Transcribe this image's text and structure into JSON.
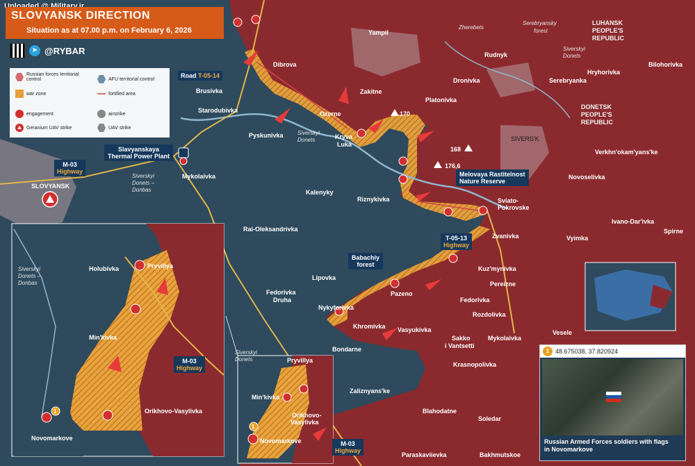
{
  "watermark": "Uploaded @ Military.ir",
  "header": {
    "title": "SLOVYANSK DIRECTION",
    "subtitle": "Situation as at 07.00 p.m. on February 6, 2026"
  },
  "brand": {
    "handle": "@RYBAR"
  },
  "legend": {
    "russian": "Russian forces territorial control",
    "afu": "AFU territorial control",
    "warzone": "war zone",
    "fortified": "fortified area",
    "engagement": "engagement",
    "airstrike": "airstrike",
    "geranium": "Geranium UAV strike",
    "uav": "UAV strike"
  },
  "colors": {
    "russian": "#8b2a2e",
    "afu": "#2e4a5c",
    "warzone": "#e8a33c",
    "road": "#e2b64a",
    "accent": "#d65a18",
    "callout": "#16385c"
  },
  "roads": {
    "t0514": {
      "a": "Road ",
      "b": "T-05-14"
    },
    "m03_top": {
      "a": "M-03",
      "b": "Highway"
    },
    "t0513": {
      "a": "T-05-13",
      "b": "Highway"
    },
    "m03_inset": {
      "a": "M-03",
      "b": "Highway"
    },
    "m03_bottom": {
      "a": "M-03",
      "b": "Highway"
    }
  },
  "callouts": {
    "power_plant": [
      "Slavyanskaya",
      "Thermal Power Plant"
    ],
    "nature_reserve": [
      "Melovaya Rastitelnost",
      "Nature Reserve"
    ],
    "forest": [
      "Babachiy",
      "forest"
    ]
  },
  "regions": {
    "luhansk": [
      "LUHANSK",
      "PEOPLE'S",
      "REPUBLIC"
    ],
    "donetsk": [
      "DONETSK",
      "PEOPLE'S",
      "REPUBLIC"
    ]
  },
  "rivers": {
    "zherebets": "Zherebets",
    "forest": [
      "Serebryansky",
      "forest"
    ],
    "seversky": [
      "Siverskyi",
      "Donets"
    ],
    "seversky_donbas": [
      "Siverskyi",
      "Donets –",
      "Donbas"
    ],
    "seversky_donets": [
      "Siverskyi",
      "Donets"
    ]
  },
  "heights": {
    "h170": "170",
    "h168": "168",
    "h176": "176,6"
  },
  "towns": {
    "yampil": "Yampil",
    "dibrova": "Dibrova",
    "brusivka": "Brusivka",
    "starodubivka": "Starodubivka",
    "zakitne": "Zakitne",
    "ozerne": "Ozerne",
    "platonivka": "Platonivka",
    "dronivka": "Dronivka",
    "rudnyk": "Rudnyk",
    "serebryanka": "Serebryanka",
    "hryhorivka": "Hryhorivka",
    "bilohorivka": "Bilohorivka",
    "siverskyi_donets_lbl": "Siverskyi Donets",
    "pyskunivka": "Pyskunivka",
    "kryva": "Kryva",
    "luka": "Luka",
    "siversk": "SIVERS'K",
    "verkhn": "Verkhn'okam'yans'ke",
    "slovyansk": "SLOVYANSK",
    "mykolaivka": "Mykolaivka",
    "kalenyky": "Kalenyky",
    "riznykivka": "Riznykivka",
    "sviato": "Sviato-",
    "pokrovske": "Pokrovske",
    "novoselivka": "Novoselivka",
    "ivano": "Ivano-Dar'ivka",
    "spirne": "Spirne",
    "rai": "Rai-Oleksandrivka",
    "zvanivka": "Zvanivka",
    "vyimka": "Vyimka",
    "kuzmynivka": "Kuz'mynivka",
    "pereizne": "Pereizne",
    "lipovka": "Lipovka",
    "pazeno": "Pazeno",
    "fedorivka_druha_1": "Fedorivka",
    "fedorivka_druha_2": "Druha",
    "nykyforivka": "Nykyforivka",
    "fedorivka": "Fedorivka",
    "rozdolivka": "Rozdolivka",
    "khromivka": "Khromivka",
    "vasyukivka": "Vasyukivka",
    "sakko_1": "Sakko",
    "sakko_2": "i Vantsetti",
    "mykolaivka2": "Mykolaivka",
    "vesele": "Vesele",
    "bondarne": "Bondarne",
    "krasnopolivka": "Krasnopolivka",
    "zaliznyanske": "Zaliznyans'ke",
    "blahodatne": "Blahodatne",
    "soledar": "Soledar",
    "paraskavievka": "Paraskaviievka",
    "bakhmutskoe": "Bakhmutskoe",
    "i_holubivka": "Holubivka",
    "i_pryvillya": "Pryvillya",
    "i_minkivka": "Min'kivka",
    "i_orikhovo": "Orikhovo-Vasylivka",
    "i_novomarkove": "Novomarkove",
    "i_seversky": [
      "Siverskyi",
      "Donets –",
      "Donbas"
    ],
    "s_pryvillya": "Pryvillya",
    "s_minkivka": "Min'kivka",
    "s_orikhovo_1": "Orikhovo-",
    "s_orikhovo_2": "Vasylivka",
    "s_novomarkove": "Novomarkove"
  },
  "photo": {
    "number": "1",
    "coords": "48.675038, 37.820924",
    "caption": [
      "Russian Armed Forces soldiers with flags",
      "in Novomarkove"
    ]
  },
  "inset_marker": "1"
}
